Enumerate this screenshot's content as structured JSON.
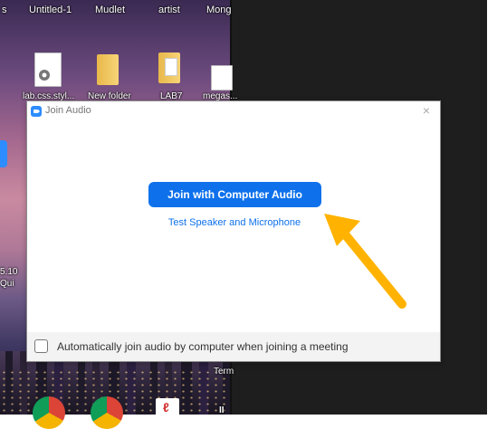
{
  "desktop": {
    "top_labels": [
      "s",
      "Untitled-1",
      "Mudlet",
      "artist",
      "Mong"
    ],
    "icons": [
      {
        "label": "lab.css.styl..."
      },
      {
        "label": "New folder"
      },
      {
        "label": "LAB7"
      },
      {
        "label": "megas..."
      }
    ],
    "partial_labels": [
      "5.10",
      "Qui",
      "Term",
      "II"
    ]
  },
  "dialog": {
    "title": "Join Audio",
    "close_glyph": "×",
    "join_button_label": "Join with Computer Audio",
    "test_link_label": "Test Speaker and Microphone",
    "auto_join_label": "Automatically join audio by computer when joining a meeting",
    "auto_join_checked": false
  },
  "annotation": {
    "arrow_color": "#FFB300"
  },
  "colors": {
    "accent": "#0E71EB",
    "zoom_brand": "#2D8CFF"
  }
}
